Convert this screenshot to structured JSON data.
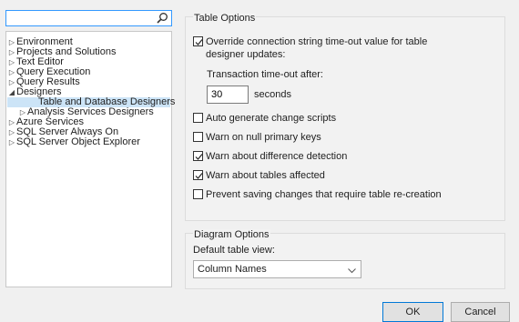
{
  "search": {
    "value": "",
    "placeholder": ""
  },
  "tree": {
    "items": [
      {
        "label": "Environment",
        "arrow": "▷",
        "indent": 0
      },
      {
        "label": "Projects and Solutions",
        "arrow": "▷",
        "indent": 0
      },
      {
        "label": "Text Editor",
        "arrow": "▷",
        "indent": 0
      },
      {
        "label": "Query Execution",
        "arrow": "▷",
        "indent": 0
      },
      {
        "label": "Query Results",
        "arrow": "▷",
        "indent": 0
      },
      {
        "label": "Designers",
        "arrow": "◢",
        "indent": 0
      },
      {
        "label": "Table and Database Designers",
        "arrow": "",
        "indent": 1,
        "selected": true
      },
      {
        "label": "Analysis Services Designers",
        "arrow": "▷",
        "indent": 1
      },
      {
        "label": "Azure Services",
        "arrow": "▷",
        "indent": 0
      },
      {
        "label": "SQL Server Always On",
        "arrow": "▷",
        "indent": 0
      },
      {
        "label": "SQL Server Object Explorer",
        "arrow": "▷",
        "indent": 0
      }
    ]
  },
  "table_options": {
    "title": "Table Options",
    "override_line1": "Override connection string time-out value for table",
    "override_line2": "designer updates:",
    "override_checked": true,
    "transaction_label": "Transaction time-out after:",
    "timeout_value": "30",
    "seconds_label": "seconds",
    "checkboxes": [
      {
        "label": "Auto generate change scripts",
        "checked": false
      },
      {
        "label": "Warn on null primary keys",
        "checked": false
      },
      {
        "label": "Warn about difference detection",
        "checked": true
      },
      {
        "label": "Warn about tables affected",
        "checked": true
      },
      {
        "label": "Prevent saving changes that require table re-creation",
        "checked": false
      }
    ]
  },
  "diagram_options": {
    "title": "Diagram Options",
    "default_view_label": "Default table view:",
    "default_view_value": "Column Names"
  },
  "buttons": {
    "ok": "OK",
    "cancel": "Cancel"
  },
  "colors": {
    "selection": "#cce4f7",
    "focus_border": "#3399ff",
    "default_button_border": "#0078d7"
  }
}
